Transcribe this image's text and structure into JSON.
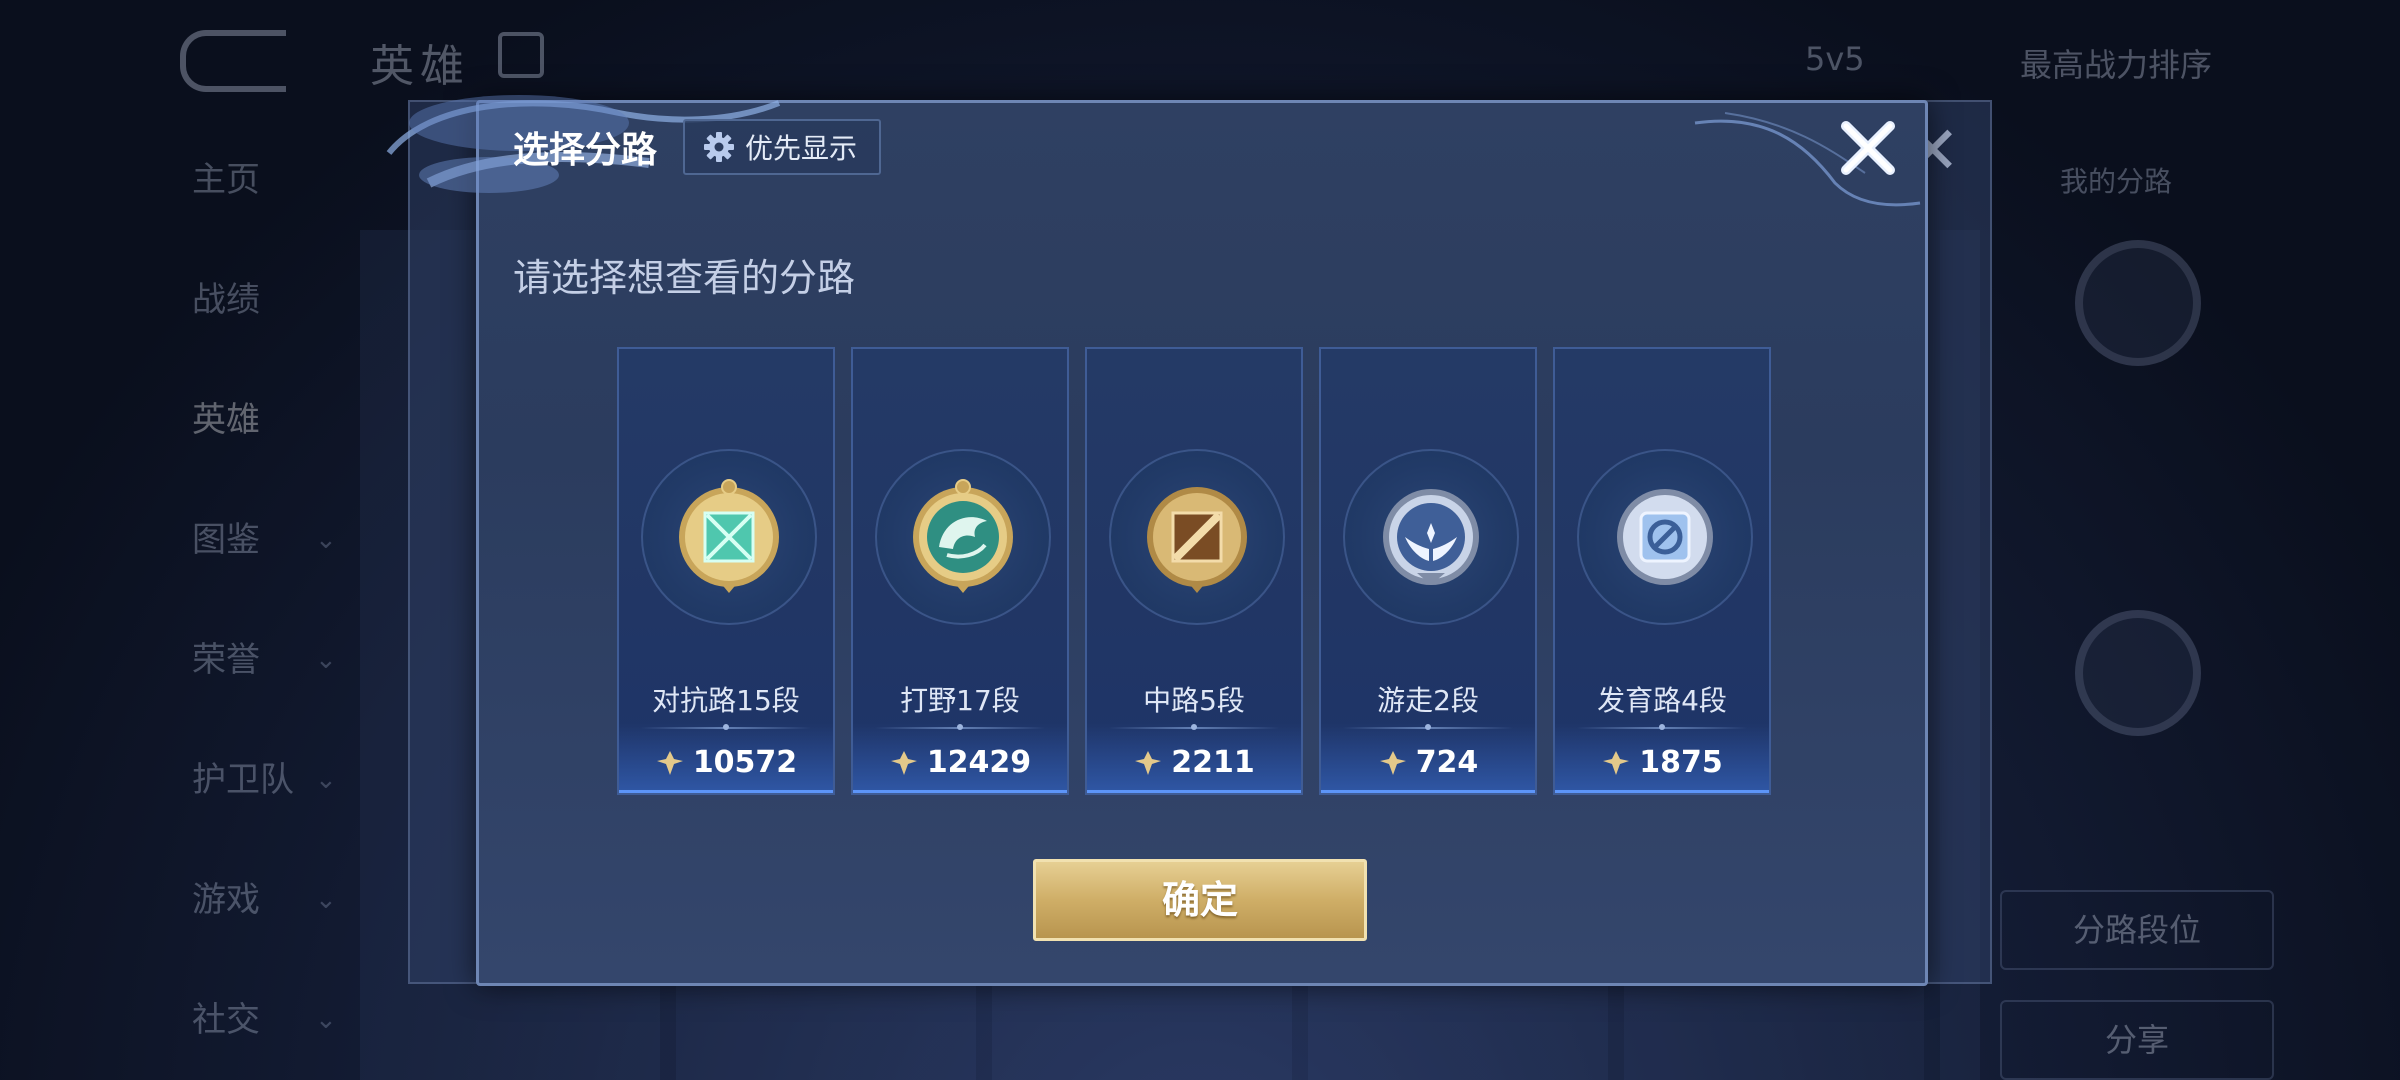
{
  "background": {
    "header_title": "英雄",
    "filter_mode": "5v5",
    "filter_sort": "最高战力排序",
    "nav_items": [
      {
        "label": "主页",
        "chevron": false
      },
      {
        "label": "战绩",
        "chevron": false
      },
      {
        "label": "英雄",
        "chevron": false
      },
      {
        "label": "图鉴",
        "chevron": true
      },
      {
        "label": "荣誉",
        "chevron": true
      },
      {
        "label": "护卫队",
        "chevron": true
      },
      {
        "label": "游戏",
        "chevron": true
      },
      {
        "label": "社交",
        "chevron": true
      }
    ],
    "right_panel": {
      "label_top": "我的分路",
      "button_lane_rank": "分路段位",
      "button_share": "分享"
    }
  },
  "modal": {
    "title": "选择分路",
    "priority_button": "优先显示",
    "close_icon": "close-icon",
    "subtitle": "请选择想查看的分路",
    "confirm_button": "确定",
    "lanes": [
      {
        "name": "对抗路15段",
        "score": "10572",
        "emblem": "clash-lane-emblem-icon",
        "tier": "gold",
        "inner_color": "#4fc7ae"
      },
      {
        "name": "打野17段",
        "score": "12429",
        "emblem": "jungle-emblem-icon",
        "tier": "gold",
        "inner_color": "#2f8f82"
      },
      {
        "name": "中路5段",
        "score": "2211",
        "emblem": "mid-lane-emblem-icon",
        "tier": "bronze",
        "inner_color": "#c28a4a"
      },
      {
        "name": "游走2段",
        "score": "724",
        "emblem": "roam-emblem-icon",
        "tier": "silver",
        "inner_color": "#9fb8e0"
      },
      {
        "name": "发育路4段",
        "score": "1875",
        "emblem": "farm-lane-emblem-icon",
        "tier": "silver",
        "inner_color": "#9fc2ee"
      }
    ]
  }
}
